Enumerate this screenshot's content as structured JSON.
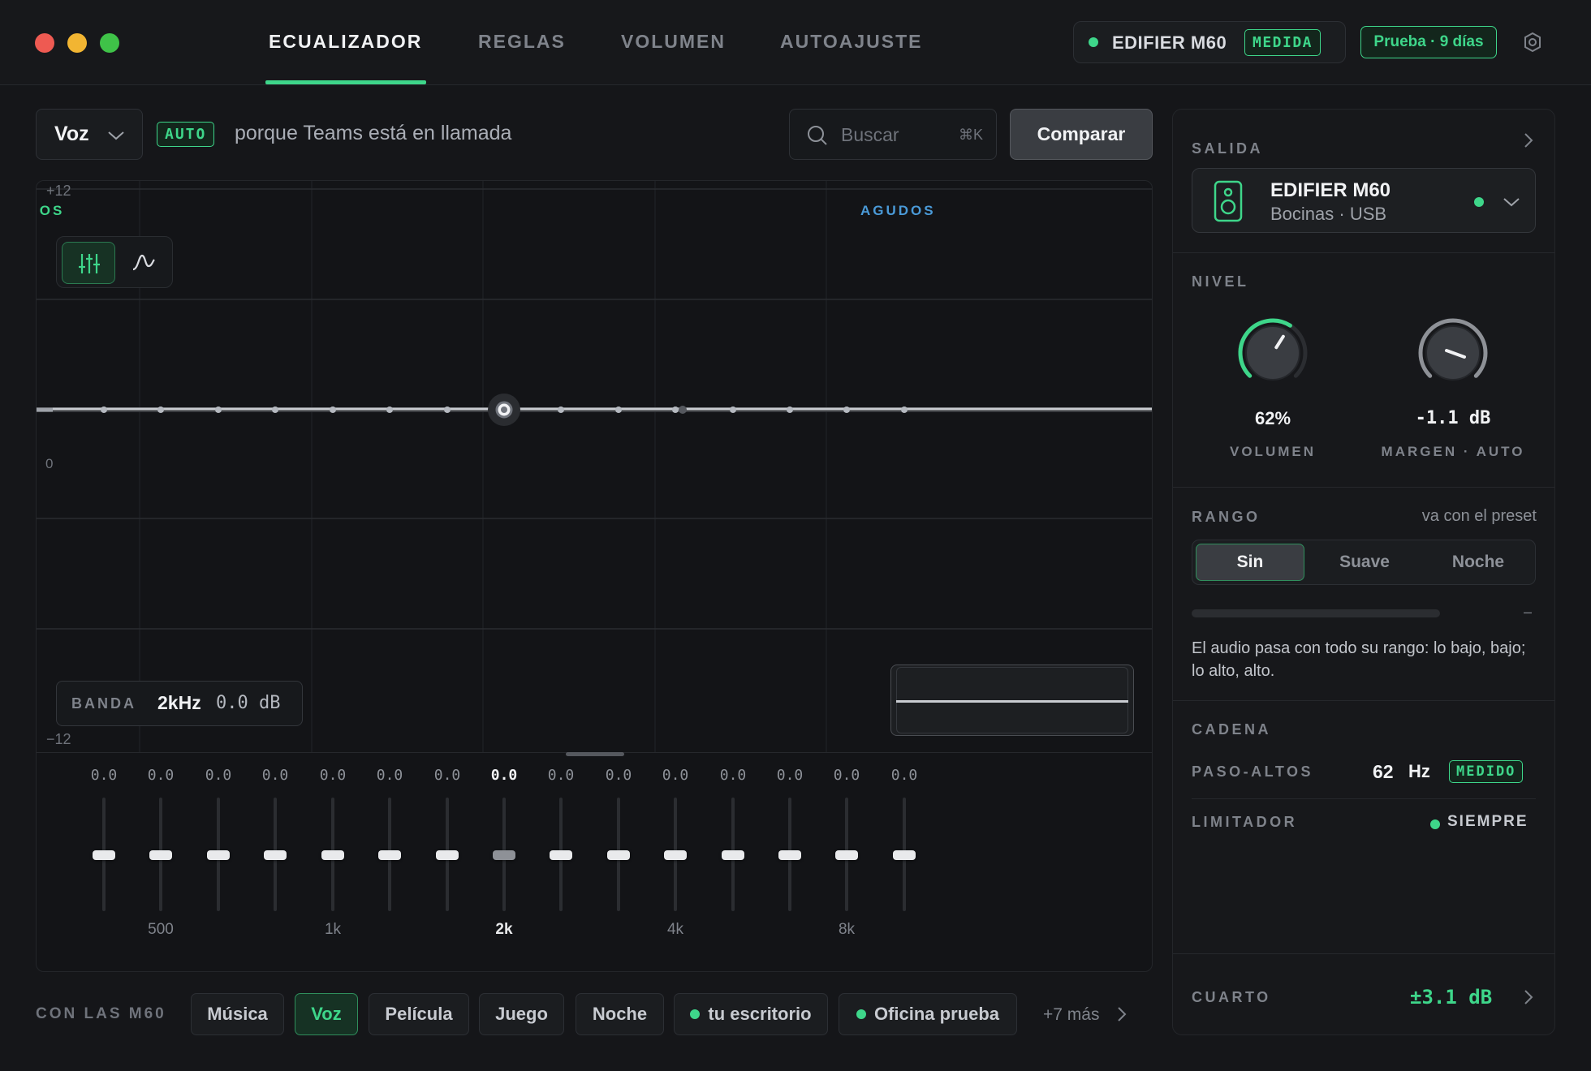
{
  "colors": {
    "accent": "#3ed68a",
    "high_zone": "#4a9ad8",
    "bg": "#151619",
    "panel": "#17181b"
  },
  "header": {
    "tabs": [
      "ECUALIZADOR",
      "REGLAS",
      "VOLUMEN",
      "AUTOAJUSTE"
    ],
    "active_tab": "ECUALIZADOR",
    "device": {
      "name": "EDIFIER M60",
      "badge": "MEDIDA"
    },
    "trial": "Prueba · 9 días",
    "settings_icon": "gear-icon"
  },
  "toolbar": {
    "preset": "Voz",
    "auto_badge": "AUTO",
    "auto_reason": "porque Teams está en llamada",
    "search_placeholder": "Buscar",
    "search_shortcut": "⌘K",
    "compare_label": "Comparar"
  },
  "eq": {
    "y_top": "+12",
    "y_bottom": "−12",
    "y_zero": "0",
    "zone_low": "IOS",
    "zone_high": "AGUDOS",
    "selected_band": {
      "label": "BANDA",
      "freq": "2kHz",
      "gain": "0.0 dB"
    },
    "bands": [
      {
        "gain": "0.0",
        "label": ""
      },
      {
        "gain": "0.0",
        "label": "500"
      },
      {
        "gain": "0.0",
        "label": ""
      },
      {
        "gain": "0.0",
        "label": ""
      },
      {
        "gain": "0.0",
        "label": "1k"
      },
      {
        "gain": "0.0",
        "label": ""
      },
      {
        "gain": "0.0",
        "label": ""
      },
      {
        "gain": "0.0",
        "label": "2k",
        "selected": true
      },
      {
        "gain": "0.0",
        "label": ""
      },
      {
        "gain": "0.0",
        "label": ""
      },
      {
        "gain": "0.0",
        "label": "4k"
      },
      {
        "gain": "0.0",
        "label": ""
      },
      {
        "gain": "0.0",
        "label": ""
      },
      {
        "gain": "0.0",
        "label": "8k"
      },
      {
        "gain": "0.0",
        "label": ""
      }
    ]
  },
  "presets": {
    "heading": "CON LAS M60",
    "chips": [
      {
        "label": "Música",
        "active": false,
        "dot": false
      },
      {
        "label": "Voz",
        "active": true,
        "dot": false
      },
      {
        "label": "Película",
        "active": false,
        "dot": false
      },
      {
        "label": "Juego",
        "active": false,
        "dot": false
      },
      {
        "label": "Noche",
        "active": false,
        "dot": false
      },
      {
        "label": "tu escritorio",
        "active": false,
        "dot": true
      },
      {
        "label": "Oficina prueba",
        "active": false,
        "dot": true
      }
    ],
    "more": "+7 más"
  },
  "side": {
    "output": {
      "heading": "SALIDA",
      "name": "EDIFIER M60",
      "sub": "Bocinas · USB"
    },
    "level": {
      "heading": "NIVEL",
      "volume": {
        "value": "62%",
        "label": "VOLUMEN",
        "fraction": 0.62
      },
      "margin": {
        "value": "-1.1 dB",
        "label": "MARGEN · AUTO"
      }
    },
    "range": {
      "heading": "RANGO",
      "note": "va con el preset",
      "options": [
        "Sin",
        "Suave",
        "Noche"
      ],
      "active": "Sin",
      "dash": "–",
      "description": "El audio pasa con todo su rango: lo bajo, bajo; lo alto, alto."
    },
    "chain": {
      "heading": "CADENA",
      "highpass": {
        "label": "PASO-ALTOS",
        "value": "62",
        "unit": "Hz",
        "badge": "MEDIDO"
      },
      "limiter": {
        "label": "LIMITADOR",
        "value": "SIEMPRE"
      }
    },
    "room": {
      "label": "CUARTO",
      "value": "±3.1 dB"
    }
  }
}
